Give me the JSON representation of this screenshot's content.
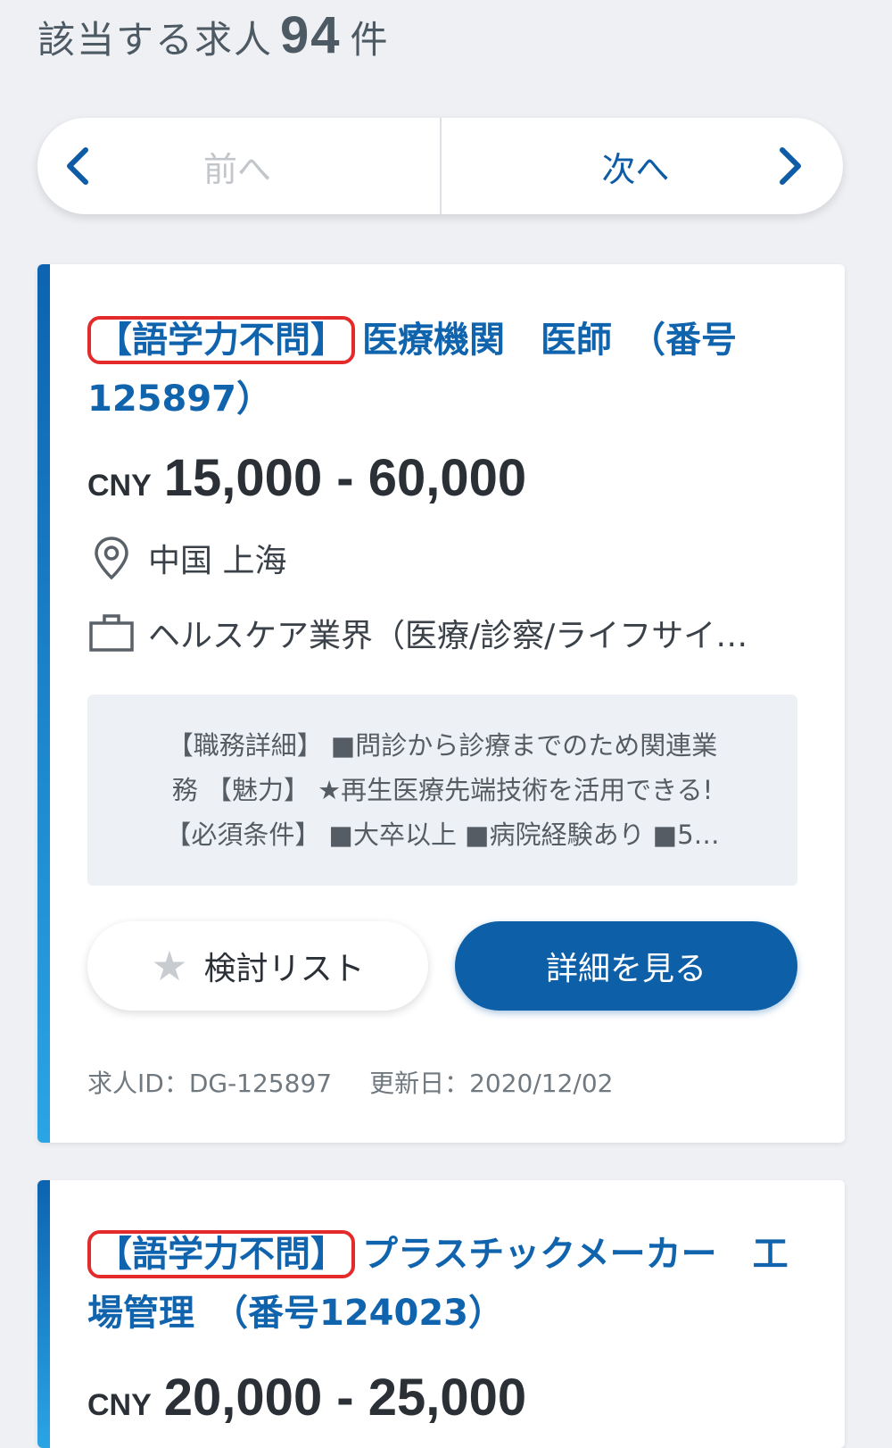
{
  "results": {
    "prefix": "該当する求人",
    "count": "94",
    "suffix": "件"
  },
  "pager": {
    "prev_label": "前へ",
    "next_label": "次へ"
  },
  "jobs": [
    {
      "tag": "【語学力不問】",
      "title": "医療機関　医師　（番号125897）",
      "currency": "CNY",
      "salary_range": "15,000 - 60,000",
      "location": "中国 上海",
      "industry": "ヘルスケア業界（医療/診察/ライフサイ…",
      "description": [
        "【職務詳細】 ■問診から診療までのため関連業",
        "務 【魅力】 ★再生医療先端技術を活用できる!",
        "【必須条件】 ■大卒以上 ■病院経験あり ■5…"
      ],
      "favorite_label": "検討リスト",
      "detail_label": "詳細を見る",
      "job_id": "求人ID：DG-125897",
      "updated": "更新日：2020/12/02"
    },
    {
      "tag": "【語学力不問】",
      "title": "プラスチックメーカー　工場管理　（番号124023）",
      "currency": "CNY",
      "salary_range": "20,000 - 25,000"
    }
  ],
  "colors": {
    "accent": "#1063ad",
    "button_primary": "#0d5fa8",
    "tag_highlight": "#e32b2b",
    "background": "#eef0f4"
  },
  "icons": [
    "chevron-left-icon",
    "chevron-right-icon",
    "location-pin-icon",
    "briefcase-icon",
    "star-icon"
  ]
}
